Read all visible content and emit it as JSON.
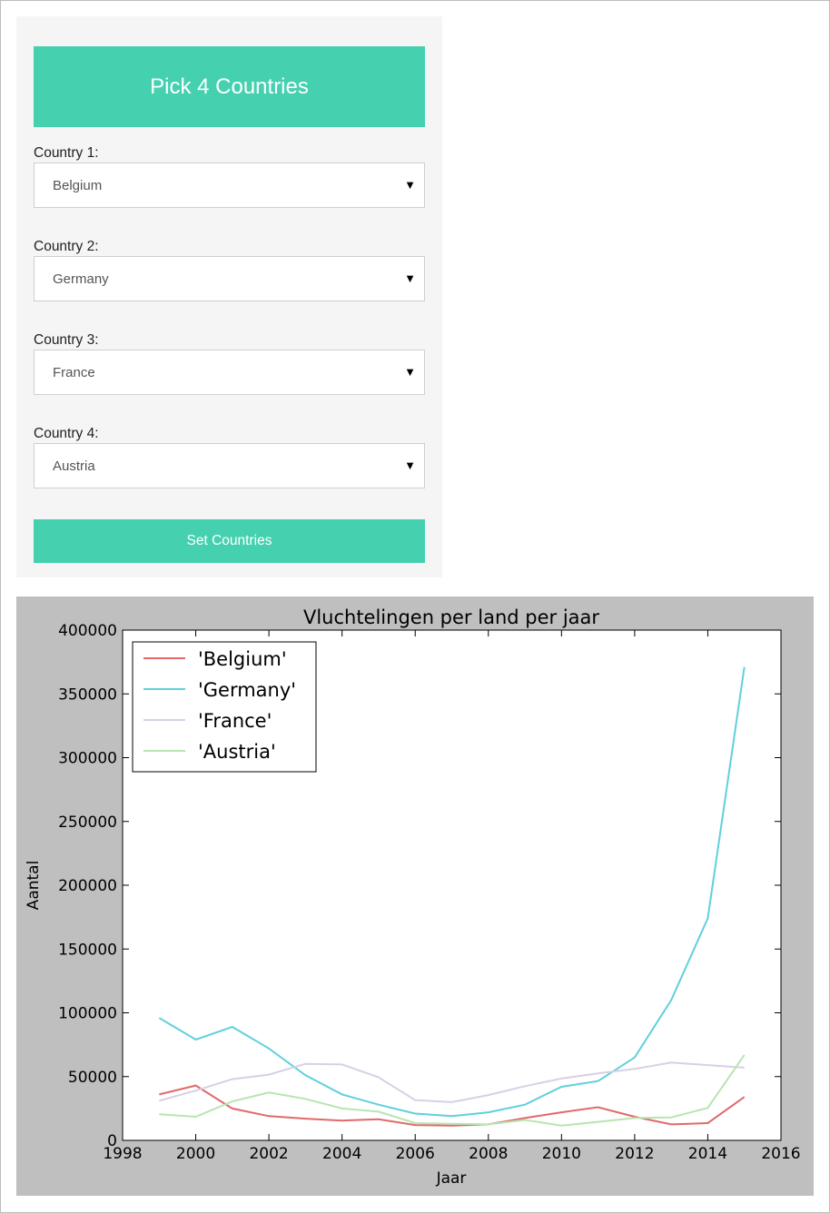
{
  "colors": {
    "accent": "#45d1b0",
    "chart_bg": "#bfbfbf",
    "belgium": "#e06a6a",
    "germany": "#5fd0dc",
    "france": "#d9cfe6",
    "austria": "#b8e5b0"
  },
  "form": {
    "title": "Pick 4 Countries",
    "fields": [
      {
        "label": "Country 1:",
        "value": "Belgium"
      },
      {
        "label": "Country 2:",
        "value": "Germany"
      },
      {
        "label": "Country 3:",
        "value": "France"
      },
      {
        "label": "Country 4:",
        "value": "Austria"
      }
    ],
    "submit_label": "Set Countries",
    "dropdown_icon": "triangle-down-icon"
  },
  "chart_data": {
    "type": "line",
    "title": "Vluchtelingen per land per jaar",
    "xlabel": "Jaar",
    "ylabel": "Aantal",
    "xlim": [
      1998,
      2016
    ],
    "ylim": [
      0,
      400000
    ],
    "xticks": [
      1998,
      2000,
      2002,
      2004,
      2006,
      2008,
      2010,
      2012,
      2014,
      2016
    ],
    "yticks": [
      0,
      50000,
      100000,
      150000,
      200000,
      250000,
      300000,
      350000,
      400000
    ],
    "grid": false,
    "legend_position": "top-left",
    "x": [
      1999,
      2000,
      2001,
      2002,
      2003,
      2004,
      2005,
      2006,
      2007,
      2008,
      2009,
      2010,
      2011,
      2012,
      2013,
      2014,
      2015
    ],
    "series": [
      {
        "name": "'Belgium'",
        "color_key": "belgium",
        "values": [
          36000,
          43000,
          25000,
          19000,
          17000,
          15500,
          16500,
          12000,
          11500,
          12500,
          17500,
          22000,
          26000,
          18500,
          12500,
          13500,
          34000
        ]
      },
      {
        "name": "'Germany'",
        "color_key": "germany",
        "values": [
          96000,
          79000,
          89000,
          72000,
          51000,
          36000,
          28000,
          21000,
          19000,
          22000,
          28000,
          42000,
          46500,
          65000,
          110000,
          174000,
          371000
        ]
      },
      {
        "name": "'France'",
        "color_key": "france",
        "values": [
          31000,
          39000,
          48000,
          51500,
          60000,
          59500,
          49500,
          31500,
          30000,
          35500,
          42500,
          48500,
          52500,
          56000,
          61000,
          59000,
          57000
        ]
      },
      {
        "name": "'Austria'",
        "color_key": "austria",
        "values": [
          20500,
          18500,
          30500,
          37500,
          32500,
          25000,
          22500,
          13500,
          13000,
          12500,
          16000,
          11500,
          14500,
          17500,
          18000,
          25500,
          67000
        ]
      }
    ]
  }
}
